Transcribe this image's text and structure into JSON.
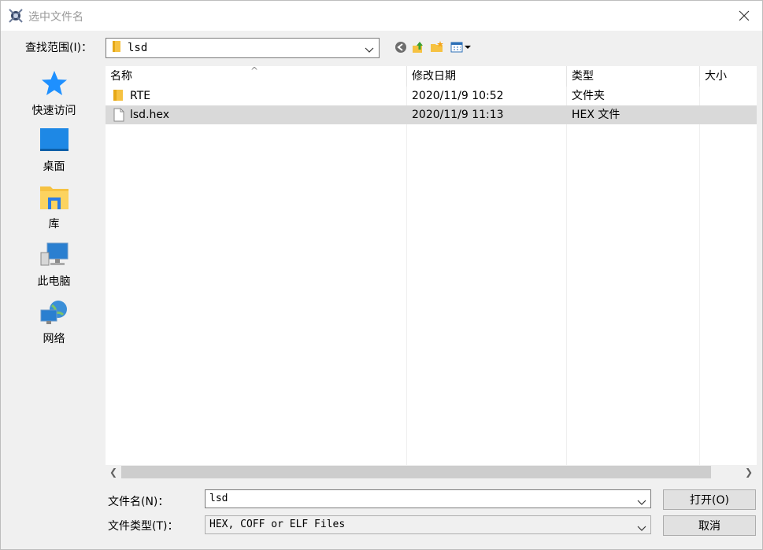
{
  "window": {
    "title": "选中文件名",
    "close_glyph": "✕"
  },
  "lookin": {
    "label": "查找范围(I)：",
    "value": "lsd"
  },
  "places": [
    {
      "label": "快速访问",
      "icon": "star-icon"
    },
    {
      "label": "桌面",
      "icon": "desktop-icon"
    },
    {
      "label": "库",
      "icon": "library-icon"
    },
    {
      "label": "此电脑",
      "icon": "computer-icon"
    },
    {
      "label": "网络",
      "icon": "network-icon"
    }
  ],
  "columns": {
    "name": "名称",
    "date": "修改日期",
    "type": "类型",
    "size": "大小"
  },
  "files": [
    {
      "name": "RTE",
      "date": "2020/11/9 10:52",
      "type": "文件夹",
      "icon": "folder-icon",
      "selected": false
    },
    {
      "name": "lsd.hex",
      "date": "2020/11/9 11:13",
      "type": "HEX 文件",
      "icon": "file-icon",
      "selected": true
    }
  ],
  "filename": {
    "label": "文件名(N)：",
    "value": "lsd"
  },
  "filetype": {
    "label": "文件类型(T)：",
    "value": "HEX, COFF or ELF Files"
  },
  "buttons": {
    "open": "打开(O)",
    "cancel": "取消"
  },
  "colors": {
    "folder": "#f6c242",
    "selection": "#d9d9d9",
    "accent": "#1e90ff"
  }
}
